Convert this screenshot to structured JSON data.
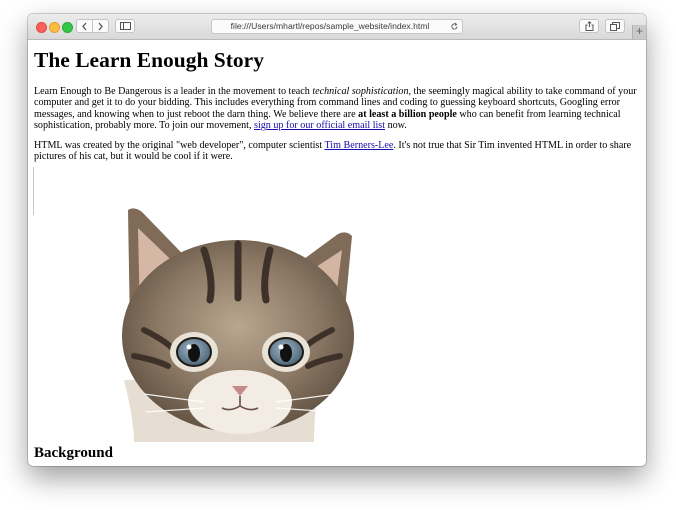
{
  "browser": {
    "url": "file:///Users/mhartl/repos/sample_website/index.html",
    "new_tab_label": "+",
    "icons": [
      "back-icon",
      "forward-icon",
      "sidebar-icon",
      "reload-icon",
      "share-icon",
      "tabs-icon"
    ]
  },
  "page": {
    "title": "The Learn Enough Story",
    "p1": {
      "t1": "Learn Enough to Be Dangerous is a leader in the movement to teach ",
      "em": "technical sophistication",
      "t2": ", the seemingly magical ability to take command of your computer and get it to do your bidding. This includes everything from command lines and coding to guessing keyboard shortcuts, Googling error messages, and knowing when to just reboot the darn thing. We believe there are ",
      "strong": "at least a billion people",
      "t3": " who can benefit from learning technical sophistication, probably more. To join our movement, ",
      "link": "sign up for our official email list",
      "t4": " now."
    },
    "p2": {
      "t1": "HTML was created by the original \"web developer\", computer scientist ",
      "link": "Tim Berners-Lee",
      "t2": ". It's not true that Sir Tim invented HTML in order to share pictures of his cat, but it would be cool if it were."
    },
    "image_subject": "kitten photo",
    "heading2": "Background"
  }
}
